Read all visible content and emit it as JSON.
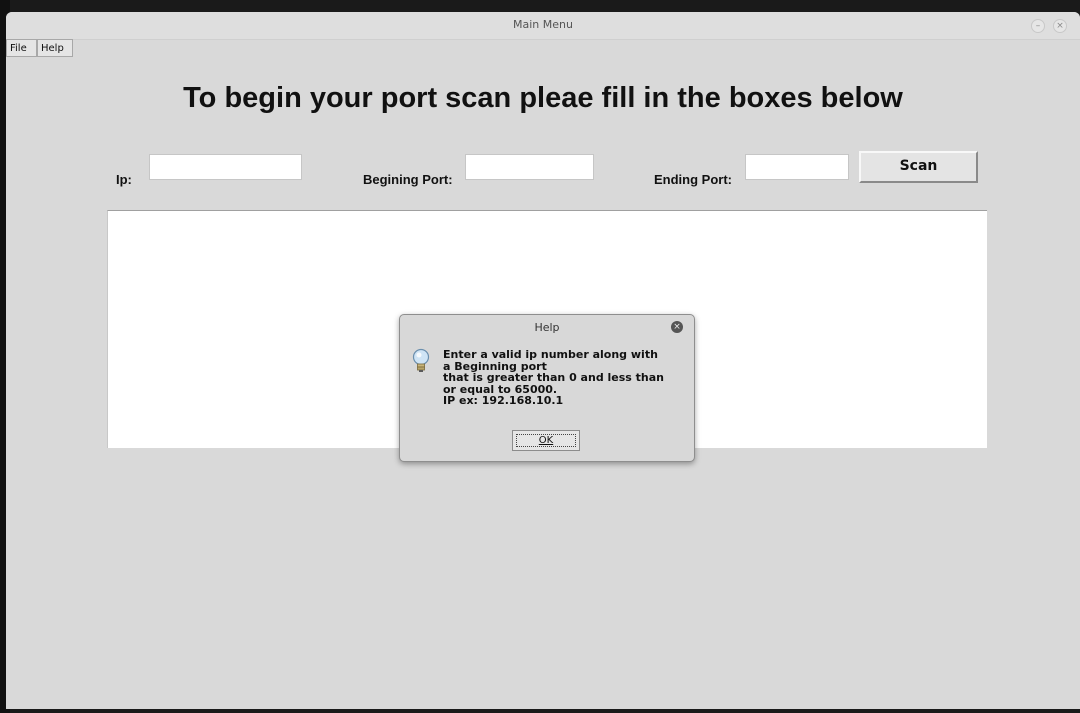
{
  "window": {
    "title": "Main Menu",
    "minimize_glyph": "–",
    "close_glyph": "×"
  },
  "menu": {
    "file": "File",
    "help": "Help"
  },
  "heading": "To begin your port scan pleae fill in the boxes below",
  "form": {
    "ip_label": "Ip:",
    "ip_value": "",
    "begin_label": "Begining Port:",
    "begin_value": "",
    "end_label": "Ending Port:",
    "end_value": "",
    "scan_label": "Scan"
  },
  "dialog": {
    "title": "Help",
    "close_glyph": "×",
    "icon": "lightbulb-icon",
    "message_lines": [
      "Enter a valid ip number along with",
      "a Beginning port",
      "that is greater than 0 and less than",
      "or equal to 65000.",
      "IP ex: 192.168.10.1"
    ],
    "ok_label": "OK"
  }
}
